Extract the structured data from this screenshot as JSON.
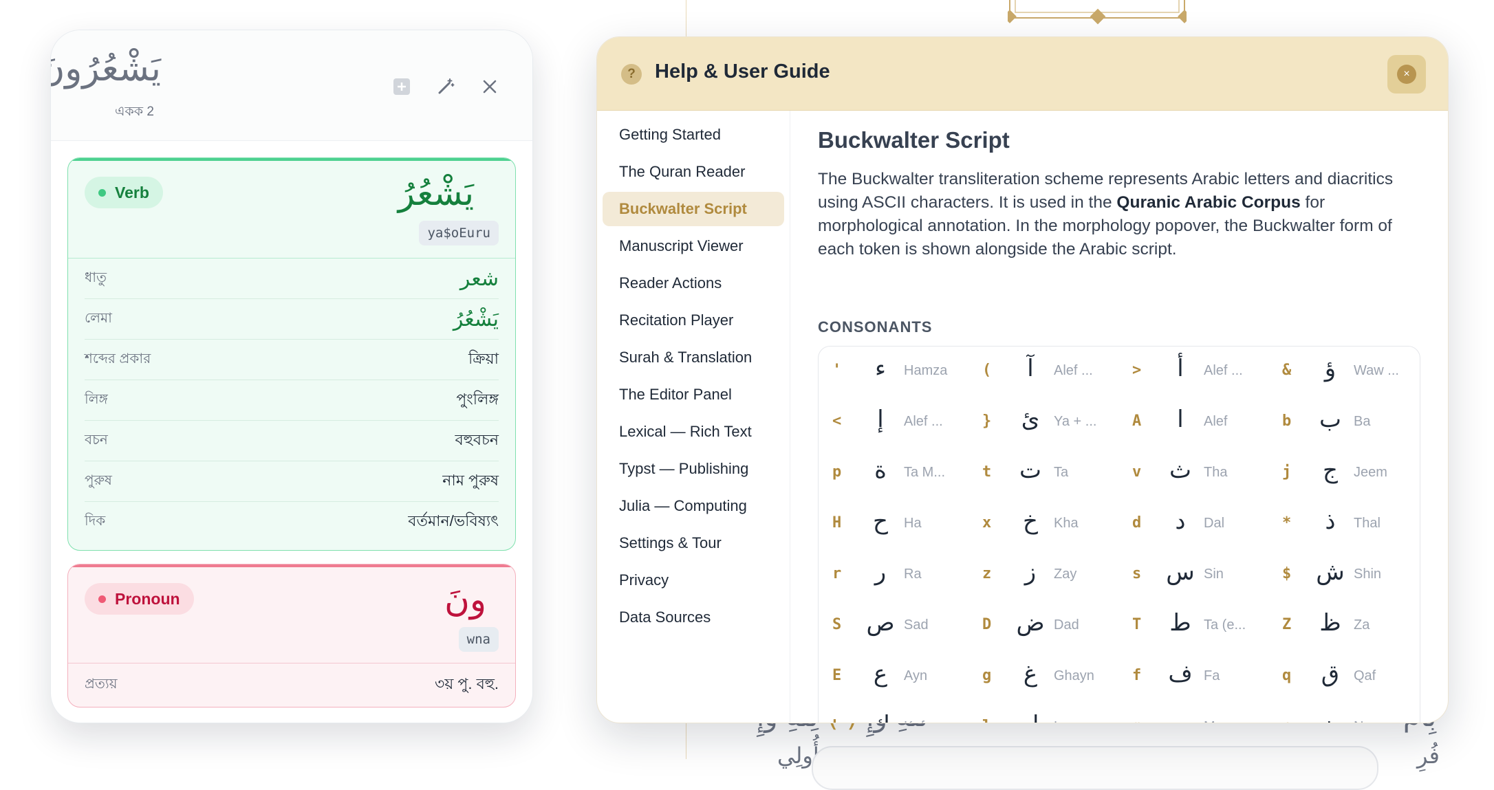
{
  "background": {
    "arabic_line_1_left": "لِّلَّهِ وَإِ",
    "arabic_line_1_hl": "( )",
    "arabic_line_1_right": "لِلَّهِ وَإِ",
    "arabic_line_1_end": "بِأَمْ",
    "arabic_line_2": "أُولِي",
    "arabic_line_2_end": "فُرِ"
  },
  "morph": {
    "word": "يَشْعُرُونَ",
    "unit": "একক 2",
    "plus_icon": "plus-square-icon",
    "wand_icon": "magic-wand-icon",
    "close_icon": "close-icon",
    "verb": {
      "badge": "Verb",
      "arabic": "يَشْعُرُ",
      "buckwalter": "ya$oEuru",
      "rows": [
        {
          "k": "ধাতু",
          "v": "شعر"
        },
        {
          "k": "লেমা",
          "v": "يَشْعُرُ"
        },
        {
          "k": "শব্দের প্রকার",
          "v": "ক্রিয়া"
        },
        {
          "k": "লিঙ্গ",
          "v": "পুংলিঙ্গ"
        },
        {
          "k": "বচন",
          "v": "বহুবচন"
        },
        {
          "k": "পুরুষ",
          "v": "নাম পুরুষ"
        },
        {
          "k": "দিক",
          "v": "বর্তমান/ভবিষ্যৎ"
        }
      ]
    },
    "pronoun": {
      "badge": "Pronoun",
      "arabic": "ونَ",
      "buckwalter": "wna",
      "rows": [
        {
          "k": "প্রত্যয়",
          "v": "৩য় পু. বহু."
        }
      ]
    }
  },
  "help": {
    "title": "Help & User Guide",
    "question_glyph": "?",
    "close_glyph": "×",
    "nav": [
      "Getting Started",
      "The Quran Reader",
      "Buckwalter Script",
      "Manuscript Viewer",
      "Reader Actions",
      "Recitation Player",
      "Surah & Translation",
      "The Editor Panel",
      "Lexical — Rich Text",
      "Typst — Publishing",
      "Julia — Computing",
      "Settings & Tour",
      "Privacy",
      "Data Sources"
    ],
    "active_nav": "Buckwalter Script",
    "section_title": "Buckwalter Script",
    "para_part1": "The Buckwalter transliteration scheme represents Arabic letters and diacritics using ASCII characters. It is used in the ",
    "para_bold": "Quranic Arabic Corpus",
    "para_part2": " for morphological annotation. In the morphology popover, the Buckwalter form of each token is shown alongside the Arabic script.",
    "consonants_heading": "CONSONANTS",
    "consonants": [
      {
        "bw": "'",
        "ar": "ء",
        "name": "Hamza"
      },
      {
        "bw": "(",
        "ar": "آ",
        "name": "Alef ..."
      },
      {
        "bw": ">",
        "ar": "أ",
        "name": "Alef ..."
      },
      {
        "bw": "&",
        "ar": "ؤ",
        "name": "Waw ..."
      },
      {
        "bw": "<",
        "ar": "إ",
        "name": "Alef ..."
      },
      {
        "bw": "}",
        "ar": "ئ",
        "name": "Ya + ..."
      },
      {
        "bw": "A",
        "ar": "ا",
        "name": "Alef"
      },
      {
        "bw": "b",
        "ar": "ب",
        "name": "Ba"
      },
      {
        "bw": "p",
        "ar": "ة",
        "name": "Ta M..."
      },
      {
        "bw": "t",
        "ar": "ت",
        "name": "Ta"
      },
      {
        "bw": "v",
        "ar": "ث",
        "name": "Tha"
      },
      {
        "bw": "j",
        "ar": "ج",
        "name": "Jeem"
      },
      {
        "bw": "H",
        "ar": "ح",
        "name": "Ha"
      },
      {
        "bw": "x",
        "ar": "خ",
        "name": "Kha"
      },
      {
        "bw": "d",
        "ar": "د",
        "name": "Dal"
      },
      {
        "bw": "*",
        "ar": "ذ",
        "name": "Thal"
      },
      {
        "bw": "r",
        "ar": "ر",
        "name": "Ra"
      },
      {
        "bw": "z",
        "ar": "ز",
        "name": "Zay"
      },
      {
        "bw": "s",
        "ar": "س",
        "name": "Sin"
      },
      {
        "bw": "$",
        "ar": "ش",
        "name": "Shin"
      },
      {
        "bw": "S",
        "ar": "ص",
        "name": "Sad"
      },
      {
        "bw": "D",
        "ar": "ض",
        "name": "Dad"
      },
      {
        "bw": "T",
        "ar": "ط",
        "name": "Ta (e..."
      },
      {
        "bw": "Z",
        "ar": "ظ",
        "name": "Za"
      },
      {
        "bw": "E",
        "ar": "ع",
        "name": "Ayn"
      },
      {
        "bw": "g",
        "ar": "غ",
        "name": "Ghayn"
      },
      {
        "bw": "f",
        "ar": "ف",
        "name": "Fa"
      },
      {
        "bw": "q",
        "ar": "ق",
        "name": "Qaf"
      },
      {
        "bw": "k",
        "ar": "ك",
        "name": "Kaf"
      },
      {
        "bw": "l",
        "ar": "ل",
        "name": "Lam"
      },
      {
        "bw": "m",
        "ar": "م",
        "name": "Meem"
      },
      {
        "bw": "n",
        "ar": "ن",
        "name": "Nun"
      }
    ]
  }
}
